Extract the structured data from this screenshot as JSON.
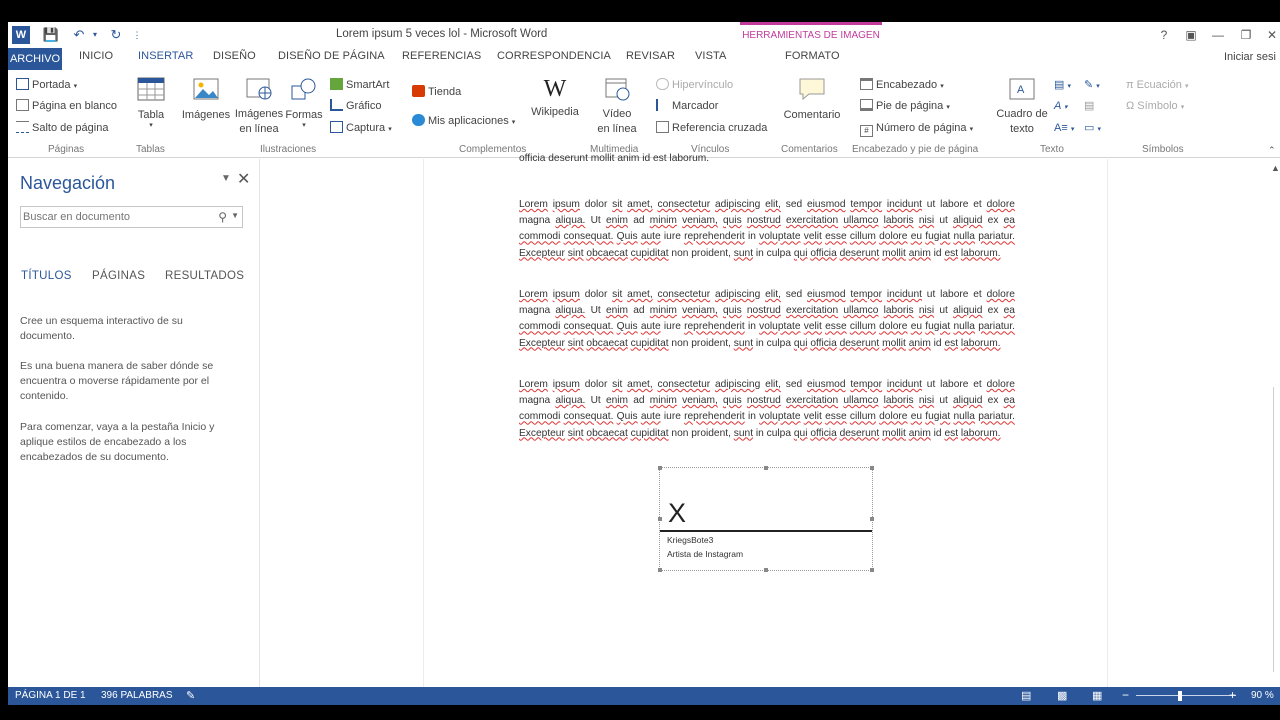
{
  "window": {
    "title": "Lorem ipsum 5 veces lol - Microsoft Word",
    "contextual_header": "HERRAMIENTAS DE IMAGEN",
    "accent_color": "#2b579a",
    "contextual_color": "#c23b9b"
  },
  "tabs": {
    "archivo": "ARCHIVO",
    "items": [
      "INICIO",
      "INSERTAR",
      "DISEÑO",
      "DISEÑO DE PÁGINA",
      "REFERENCIAS",
      "CORRESPONDENCIA",
      "REVISAR",
      "VISTA",
      "FORMATO"
    ],
    "active": "INSERTAR",
    "sign_in": "Iniciar sesi"
  },
  "ribbon": {
    "paginas": {
      "portada": "Portada",
      "pagina_en_blanco": "Página en blanco",
      "salto": "Salto de página",
      "group": "Páginas"
    },
    "tablas": {
      "tabla": "Tabla",
      "group": "Tablas"
    },
    "ilustraciones": {
      "imagenes": "Imágenes",
      "imagenes_en_linea_1": "Imágenes",
      "imagenes_en_linea_2": "en línea",
      "formas": "Formas",
      "smartart": "SmartArt",
      "grafico": "Gráfico",
      "captura": "Captura",
      "group": "Ilustraciones"
    },
    "complementos": {
      "tienda": "Tienda",
      "mis_aplicaciones": "Mis aplicaciones",
      "wikipedia": "Wikipedia",
      "group": "Complementos"
    },
    "multimedia": {
      "video_1": "Vídeo",
      "video_2": "en línea",
      "group": "Multimedia"
    },
    "vinculos": {
      "hipervinculo": "Hipervínculo",
      "marcador": "Marcador",
      "referencia": "Referencia cruzada",
      "group": "Vínculos"
    },
    "comentarios": {
      "comentario": "Comentario",
      "group": "Comentarios"
    },
    "encabezado": {
      "encabezado": "Encabezado",
      "pie": "Pie de página",
      "numero": "Número de página",
      "group": "Encabezado y pie de página"
    },
    "texto": {
      "cuadro_1": "Cuadro de",
      "cuadro_2": "texto",
      "group": "Texto"
    },
    "simbolos": {
      "ecuacion": "Ecuación",
      "simbolo": "Símbolo",
      "group": "Símbolos"
    }
  },
  "nav": {
    "title": "Navegación",
    "search_placeholder": "Buscar en documento",
    "tabs": [
      "TÍTULOS",
      "PÁGINAS",
      "RESULTADOS"
    ],
    "p1": "Cree un esquema interactivo de su documento.",
    "p2": "Es una buena manera de saber dónde se encuentra o moverse rápidamente por el contenido.",
    "p3": "Para comenzar, vaya a la pestaña Inicio y aplique estilos de encabezado a los encabezados de su documento."
  },
  "document": {
    "cut_line": "officia deserunt mollit anim id est laborum.",
    "paragraph": "Lorem ipsum dolor sit amet, consectetur adipiscing elit, sed eiusmod tempor incidunt ut labore et dolore magna aliqua. Ut enim ad minim veniam, quis nostrud exercitation ullamco laboris nisi ut aliquid ex ea commodi consequat. Quis aute iure reprehenderit in voluptate velit esse cillum dolore eu fugiat nulla pariatur. Excepteur sint obcaecat cupiditat non proident, sunt in culpa qui officia deserunt mollit anim id est laborum.",
    "signature": {
      "mark": "X",
      "name": "KriegsBote3",
      "title": "Artista de Instagram"
    }
  },
  "status": {
    "page": "PÁGINA 1 DE 1",
    "words": "396 PALABRAS",
    "zoom": "90 %",
    "zoom_level_percent": 90
  }
}
